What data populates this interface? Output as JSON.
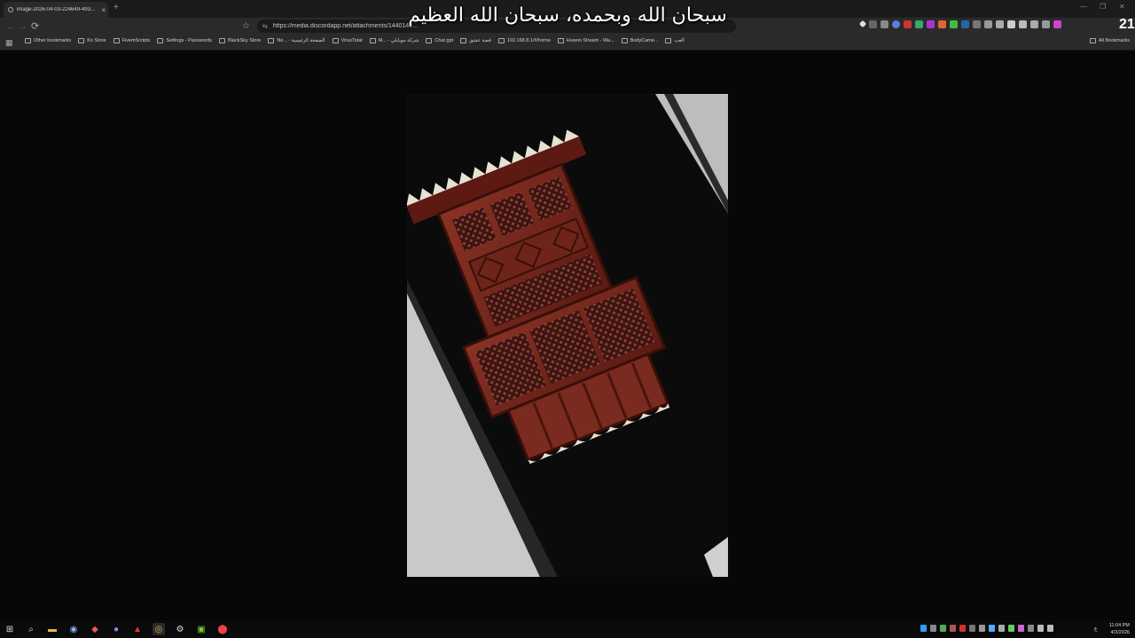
{
  "tab": {
    "title": "image-2026-04-03-224649-493...",
    "close": "×",
    "new_tab": "+"
  },
  "window": {
    "minimize": "—",
    "restore": "❐",
    "close": "✕"
  },
  "toolbar": {
    "back": "←",
    "forward": "→",
    "reload": "⟳",
    "bookmark": "☆",
    "url": "https://media.discordapp.net/attachments/1440143...",
    "profile": "21"
  },
  "overlay_text": "سبحان الله وبحمده، سبحان الله العظيم",
  "bookmarks": [
    "Other bookmarks",
    "Ko Store",
    "FivemScripts",
    "Settings - Passwords",
    "BlackSky Store",
    "Ne... - الصفحة الرئيسية",
    "VirusTotal",
    "M... - شركة موبايلي",
    "Chat gpt",
    "قصة عشق",
    "192.168.8.1/#/home",
    "Husein Stream - Wa...",
    "BodyCame...",
    "العب"
  ],
  "all_bookmarks": "All Bookmarks",
  "taskbar": {
    "clock_time": "11:04 PM",
    "clock_date": "4/3/2026",
    "lang": "ع"
  },
  "colors": {
    "wood": "#7a2a1e",
    "page_bg": "#070707"
  },
  "icons": [
    "windows-start-icon",
    "search-icon",
    "file-explorer-icon",
    "steam-icon",
    "app-icon",
    "discord-icon",
    "app-red-icon",
    "chrome-icon",
    "gear-icon",
    "nvidia-icon",
    "location-pin-icon"
  ]
}
